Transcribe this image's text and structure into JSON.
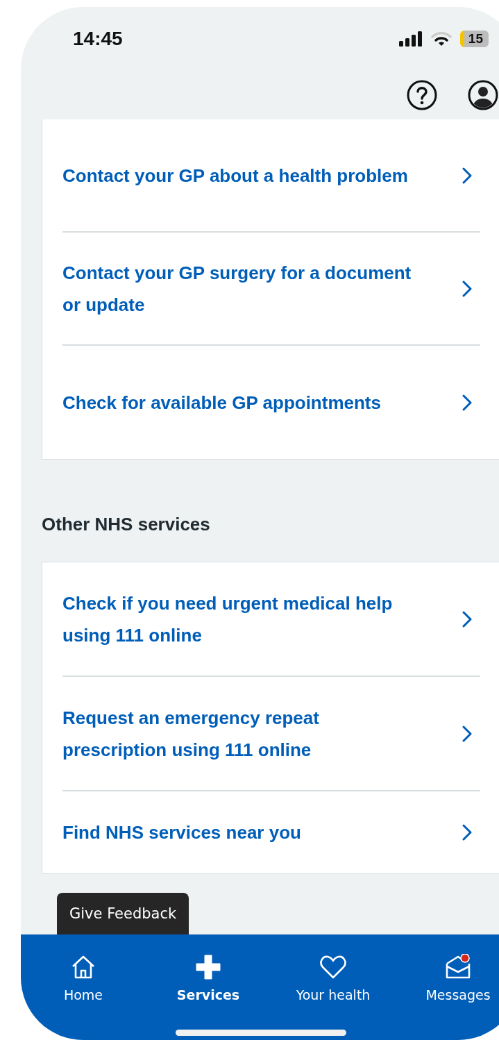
{
  "status_bar": {
    "time": "14:45",
    "battery": "15"
  },
  "top_bar": {
    "buttons": [
      {
        "kind": "help"
      },
      {
        "kind": "account"
      }
    ]
  },
  "gp_links": [
    {
      "label": "Contact your GP about a health problem"
    },
    {
      "label": "Contact your GP surgery for a document or update"
    },
    {
      "label": "Check for available GP appointments"
    }
  ],
  "other_services": {
    "heading": "Other NHS services",
    "links": [
      {
        "label": "Check if you need urgent medical help using 111 online"
      },
      {
        "label": "Request an emergency repeat prescription using 111 online"
      },
      {
        "label": "Find NHS services near you"
      }
    ]
  },
  "feedback_button": "Give Feedback",
  "tab_bar": [
    {
      "label": "Home",
      "kind": "home",
      "selected": false,
      "notification": false
    },
    {
      "label": "Services",
      "kind": "services",
      "selected": true,
      "notification": false
    },
    {
      "label": "Your health",
      "kind": "health",
      "selected": false,
      "notification": false
    },
    {
      "label": "Messages",
      "kind": "messages",
      "selected": false,
      "notification": true
    }
  ]
}
